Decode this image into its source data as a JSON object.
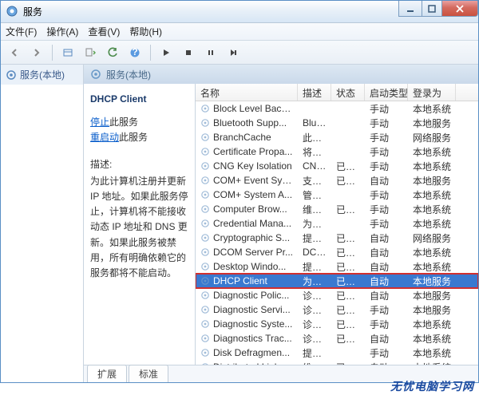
{
  "window": {
    "title": "服务"
  },
  "menu": {
    "file": "文件(F)",
    "action": "操作(A)",
    "view": "查看(V)",
    "help": "帮助(H)"
  },
  "left": {
    "root": "服务(本地)"
  },
  "addr": {
    "text": "服务(本地)"
  },
  "detail": {
    "title": "DHCP Client",
    "stop_prefix": "停止",
    "restart_prefix": "重启动",
    "link_suffix": "此服务",
    "desc_label": "描述:",
    "desc": "为此计算机注册并更新 IP 地址。如果此服务停止，计算机将不能接收动态 IP 地址和 DNS 更新。如果此服务被禁用，所有明确依赖它的服务都将不能启动。"
  },
  "columns": {
    "name": "名称",
    "desc": "描述",
    "status": "状态",
    "startup": "启动类型",
    "logon": "登录为"
  },
  "rows": [
    {
      "name": "Block Level Back...",
      "desc": "",
      "status": "",
      "startup": "手动",
      "logon": "本地系统"
    },
    {
      "name": "Bluetooth Supp...",
      "desc": "Blue...",
      "status": "",
      "startup": "手动",
      "logon": "本地服务"
    },
    {
      "name": "BranchCache",
      "desc": "此服...",
      "status": "",
      "startup": "手动",
      "logon": "网络服务"
    },
    {
      "name": "Certificate Propa...",
      "desc": "将用...",
      "status": "",
      "startup": "手动",
      "logon": "本地系统"
    },
    {
      "name": "CNG Key Isolation",
      "desc": "CNG...",
      "status": "已启动",
      "startup": "手动",
      "logon": "本地系统"
    },
    {
      "name": "COM+ Event Sys...",
      "desc": "支持...",
      "status": "已启动",
      "startup": "自动",
      "logon": "本地服务"
    },
    {
      "name": "COM+ System A...",
      "desc": "管理...",
      "status": "",
      "startup": "手动",
      "logon": "本地系统"
    },
    {
      "name": "Computer Brow...",
      "desc": "维护...",
      "status": "已启动",
      "startup": "手动",
      "logon": "本地系统"
    },
    {
      "name": "Credential Mana...",
      "desc": "为用...",
      "status": "",
      "startup": "手动",
      "logon": "本地系统"
    },
    {
      "name": "Cryptographic S...",
      "desc": "提供...",
      "status": "已启动",
      "startup": "自动",
      "logon": "网络服务"
    },
    {
      "name": "DCOM Server Pr...",
      "desc": "DCO...",
      "status": "已启动",
      "startup": "自动",
      "logon": "本地系统"
    },
    {
      "name": "Desktop Windo...",
      "desc": "提供...",
      "status": "已启动",
      "startup": "自动",
      "logon": "本地系统"
    },
    {
      "name": "DHCP Client",
      "desc": "为此...",
      "status": "已启动",
      "startup": "自动",
      "logon": "本地服务",
      "selected": true
    },
    {
      "name": "Diagnostic Polic...",
      "desc": "诊断...",
      "status": "已启动",
      "startup": "自动",
      "logon": "本地服务"
    },
    {
      "name": "Diagnostic Servi...",
      "desc": "诊断...",
      "status": "已启动",
      "startup": "手动",
      "logon": "本地服务"
    },
    {
      "name": "Diagnostic Syste...",
      "desc": "诊断...",
      "status": "已启动",
      "startup": "手动",
      "logon": "本地系统"
    },
    {
      "name": "Diagnostics Trac...",
      "desc": "诊断...",
      "status": "已启动",
      "startup": "自动",
      "logon": "本地系统"
    },
    {
      "name": "Disk Defragmen...",
      "desc": "提供...",
      "status": "",
      "startup": "手动",
      "logon": "本地系统"
    },
    {
      "name": "Distributed Link ...",
      "desc": "维护...",
      "status": "已启动",
      "startup": "自动",
      "logon": "本地系统"
    }
  ],
  "tabs": {
    "extended": "扩展",
    "standard": "标准"
  },
  "watermark": "无忧电脑学习网"
}
